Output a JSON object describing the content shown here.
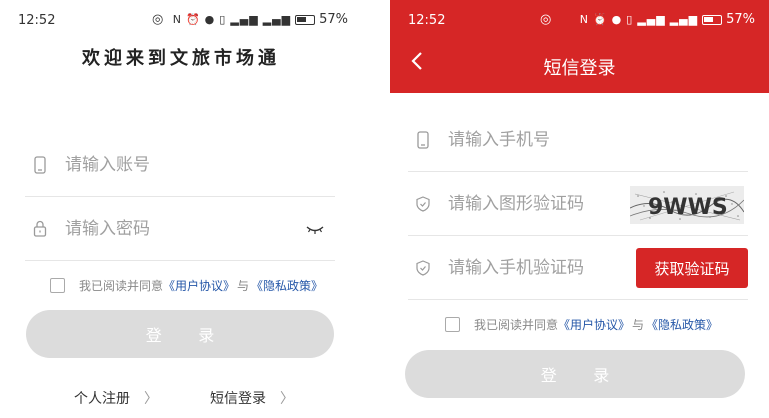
{
  "status_left": {
    "time": "12:52",
    "battery": "57%"
  },
  "status_right": {
    "time": "12:52",
    "battery": "57%"
  },
  "login": {
    "title": "欢迎来到文旅市场通",
    "account_placeholder": "请输入账号",
    "password_placeholder": "请输入密码",
    "agree_prefix": "我已阅读并同意",
    "user_agreement": "《用户协议》",
    "agree_and": "与",
    "privacy_policy": "《隐私政策》",
    "login_button": "登 录",
    "register_link": "个人注册",
    "sms_login_link": "短信登录"
  },
  "sms": {
    "title": "短信登录",
    "phone_placeholder": "请输入手机号",
    "captcha_placeholder": "请输入图形验证码",
    "captcha_text": "9WWS",
    "sms_code_placeholder": "请输入手机验证码",
    "get_code_button": "获取验证码",
    "agree_prefix": "我已阅读并同意",
    "user_agreement": "《用户协议》",
    "agree_and": "与",
    "privacy_policy": "《隐私政策》",
    "login_button": "登 录"
  },
  "colors": {
    "brand_red": "#d62626",
    "link_blue": "#2557a8",
    "disabled_button": "#dcdcdc"
  }
}
